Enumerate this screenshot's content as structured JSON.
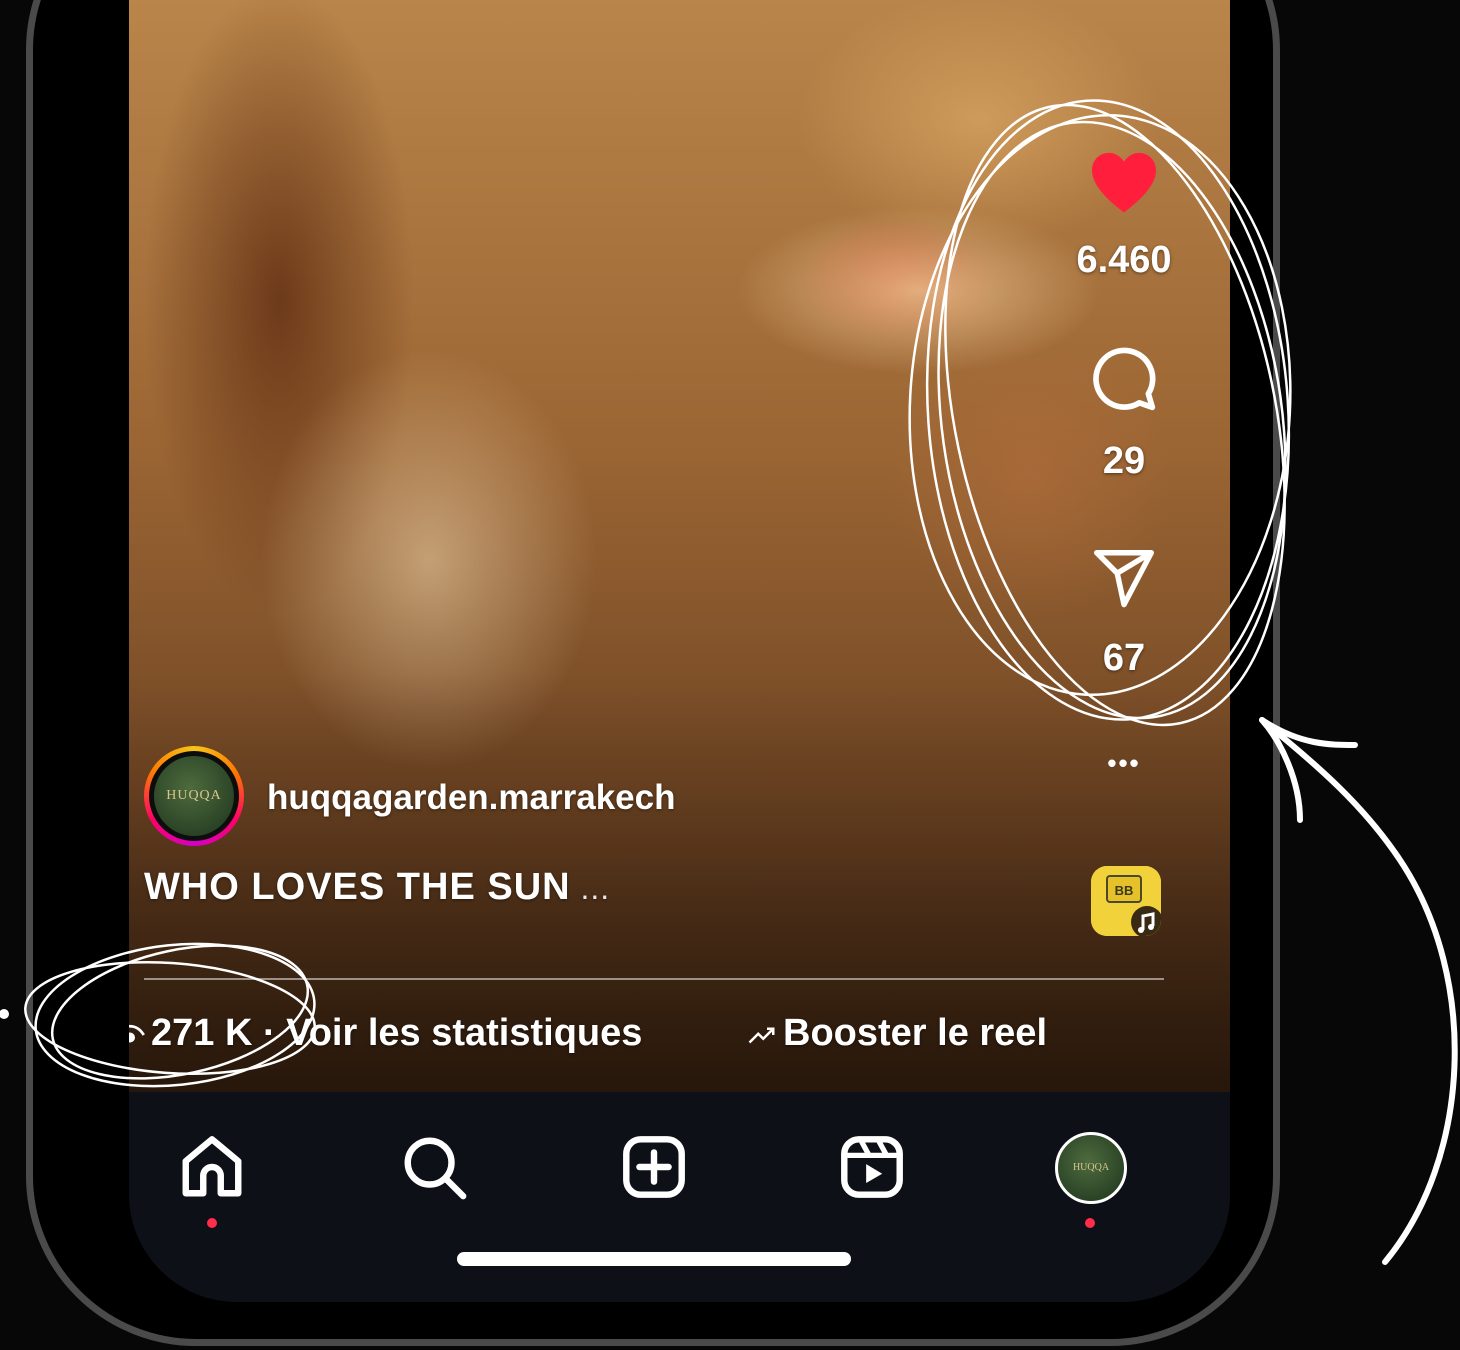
{
  "reel": {
    "likes": "6.460",
    "comments": "29",
    "shares": "67",
    "more": "•••",
    "username": "huqqagarden.marrakech",
    "avatar_text": "HUQQA",
    "caption": "WHO LOVES THE SUN",
    "caption_more": " ...",
    "views": "271 K",
    "stats_separator": " · ",
    "stats_link": "Voir les statistiques",
    "boost_label": "Booster le reel",
    "boost_icon": "trend-arrow-icon"
  },
  "nav": {
    "items": [
      "home-icon",
      "search-icon",
      "create-icon",
      "reels-icon",
      "profile-avatar"
    ],
    "profile_avatar_text": "HUQQA"
  },
  "colors": {
    "like": "#ff1f3d",
    "notification_dot": "#ff2d4a",
    "nav_background": "#0d1117",
    "annotation": "#ffffff"
  }
}
